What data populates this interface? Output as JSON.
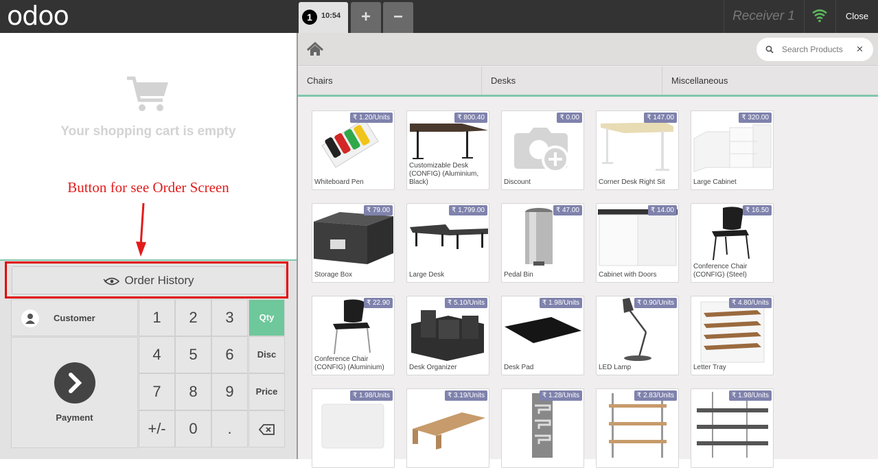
{
  "topbar": {
    "logo": "odoo",
    "order_number": "1",
    "order_time": "10:54",
    "add_order": "+",
    "remove_order": "−",
    "receiver": "Receiver 1",
    "close": "Close"
  },
  "cart": {
    "empty_message": "Your shopping cart is empty"
  },
  "annotation": {
    "text": "Button for see Order Screen"
  },
  "order_history": {
    "label": "Order History"
  },
  "actionpad": {
    "customer": "Customer",
    "payment": "Payment"
  },
  "numpad": {
    "keys": [
      "1",
      "2",
      "3",
      "4",
      "5",
      "6",
      "7",
      "8",
      "9",
      "+/-",
      "0",
      "."
    ],
    "modes": [
      "Qty",
      "Disc",
      "Price"
    ],
    "active_mode": "Qty"
  },
  "search": {
    "placeholder": "Search Products"
  },
  "categories": [
    "Chairs",
    "Desks",
    "Miscellaneous"
  ],
  "products": [
    {
      "name": "Whiteboard Pen",
      "price": "₹ 1.20/Units"
    },
    {
      "name": "Customizable Desk (CONFIG) (Aluminium, Black)",
      "price": "₹ 800.40"
    },
    {
      "name": "Discount",
      "price": "₹ 0.00"
    },
    {
      "name": "Corner Desk Right Sit",
      "price": "₹ 147.00"
    },
    {
      "name": "Large Cabinet",
      "price": "₹ 320.00"
    },
    {
      "name": "Storage Box",
      "price": "₹ 79.00"
    },
    {
      "name": "Large Desk",
      "price": "₹ 1,799.00"
    },
    {
      "name": "Pedal Bin",
      "price": "₹ 47.00"
    },
    {
      "name": "Cabinet with Doors",
      "price": "₹ 14.00"
    },
    {
      "name": "Conference Chair (CONFIG) (Steel)",
      "price": "₹ 16.50"
    },
    {
      "name": "Conference Chair (CONFIG) (Aluminium)",
      "price": "₹ 22.90"
    },
    {
      "name": "Desk Organizer",
      "price": "₹ 5.10/Units"
    },
    {
      "name": "Desk Pad",
      "price": "₹ 1.98/Units"
    },
    {
      "name": "LED Lamp",
      "price": "₹ 0.90/Units"
    },
    {
      "name": "Letter Tray",
      "price": "₹ 4.80/Units"
    },
    {
      "name": "",
      "price": "₹ 1.98/Units"
    },
    {
      "name": "",
      "price": "₹ 3.19/Units"
    },
    {
      "name": "",
      "price": "₹ 1.28/Units"
    },
    {
      "name": "",
      "price": "₹ 2.83/Units"
    },
    {
      "name": "",
      "price": "₹ 1.98/Units"
    }
  ]
}
